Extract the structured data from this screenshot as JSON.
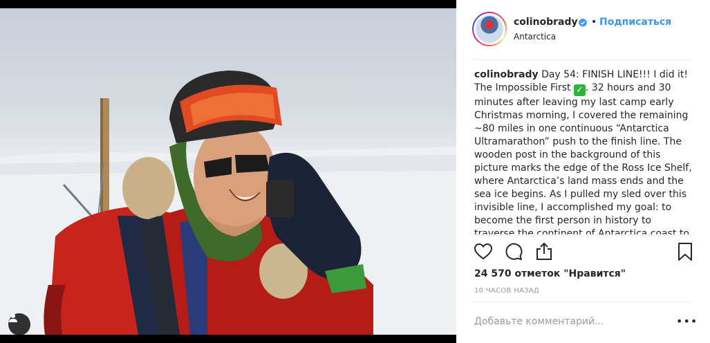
{
  "post": {
    "username": "colinobrady",
    "follow_label": "Подписаться",
    "separator": "•",
    "location": "Antarctica",
    "caption_user": "colinobrady",
    "caption_text_before_emoji": " Day 54: FINISH LINE!!! I did it! The Impossible First ",
    "caption_emoji": "✓",
    "caption_text_after_emoji": ". 32 hours and 30 minutes after leaving my last camp early Christmas morning, I covered the remaining ~80 miles in one continuous “Antarctica Ultramarathon” push to the finish line. The wooden post in the background of this picture marks the edge of the Ross Ice Shelf, where Antarctica’s land mass ends and the sea ice begins. As I pulled my sled over this invisible line, I accomplished my goal: to become the first person in history to traverse the continent of Antarctica coast to coast",
    "likes": "24 570 отметок \"Нравится\"",
    "time_ago": "10 ЧАСОВ НАЗАД",
    "comment_placeholder": "Добавьте комментарий...",
    "more_label": "•••"
  },
  "icons": {
    "verified": "verified-badge-icon",
    "like": "heart-icon",
    "comment": "comment-bubble-icon",
    "share": "share-icon",
    "save": "bookmark-icon",
    "user_tag": "user-tag-icon"
  },
  "colors": {
    "link_blue": "#3897f0",
    "text": "#262626",
    "muted": "#999999",
    "divider": "#efefef"
  }
}
